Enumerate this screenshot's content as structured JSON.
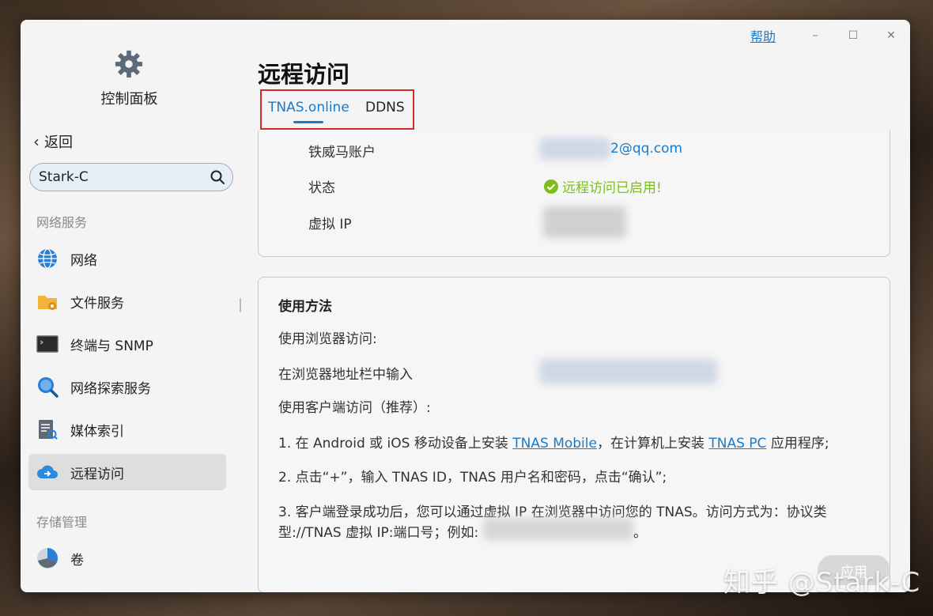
{
  "window": {
    "help_label": "帮助",
    "minimize_glyph": "–",
    "maximize_glyph": "☐",
    "close_glyph": "✕"
  },
  "sidebar": {
    "app_title": "控制面板",
    "back_label": "返回",
    "search_value": "Stark-C",
    "section_network": "网络服务",
    "items": [
      {
        "label": "网络",
        "icon": "globe-icon"
      },
      {
        "label": "文件服务",
        "icon": "folder-gear-icon"
      },
      {
        "label": "终端与 SNMP",
        "icon": "terminal-icon"
      },
      {
        "label": "网络探索服务",
        "icon": "search-discovery-icon"
      },
      {
        "label": "媒体索引",
        "icon": "media-index-icon"
      },
      {
        "label": "远程访问",
        "icon": "cloud-remote-icon",
        "active": true
      }
    ],
    "section_storage": "存储管理",
    "storage_items": [
      {
        "label": "卷",
        "icon": "volume-pie-icon"
      }
    ]
  },
  "main": {
    "title": "远程访问",
    "tabs": [
      {
        "label": "TNAS.online",
        "active": true
      },
      {
        "label": "DDNS",
        "active": false
      }
    ],
    "account": {
      "account_label": "铁威马账户",
      "account_value": "2@qq.com",
      "status_label": "状态",
      "status_value": "远程访问已启用!",
      "vip_label": "虚拟 IP"
    },
    "usage": {
      "heading": "使用方法",
      "browser_access": "使用浏览器访问:",
      "browser_input": "在浏览器地址栏中输入",
      "client_access": "使用客户端访问（推荐）:",
      "step1_a": "1. 在 Android 或 iOS 移动设备上安装 ",
      "step1_link1": "TNAS Mobile",
      "step1_b": "，在计算机上安装 ",
      "step1_link2": "TNAS PC",
      "step1_c": " 应用程序;",
      "step2": "2. 点击“+”，输入 TNAS ID，TNAS 用户名和密码，点击“确认”;",
      "step3_line1": "3. 客户端登录成功后，您可以通过虚拟 IP 在浏览器中访问您的 TNAS。访问方式为：协议类",
      "step3_line2": "型://TNAS 虚拟 IP:端口号；例如:",
      "step3_end": "。"
    },
    "apply_label": "应用"
  },
  "watermark": "知乎 @Stark-C",
  "colors": {
    "accent": "#1a7ac7",
    "success": "#7dbd1f",
    "highlight_box": "#d62a2a"
  }
}
